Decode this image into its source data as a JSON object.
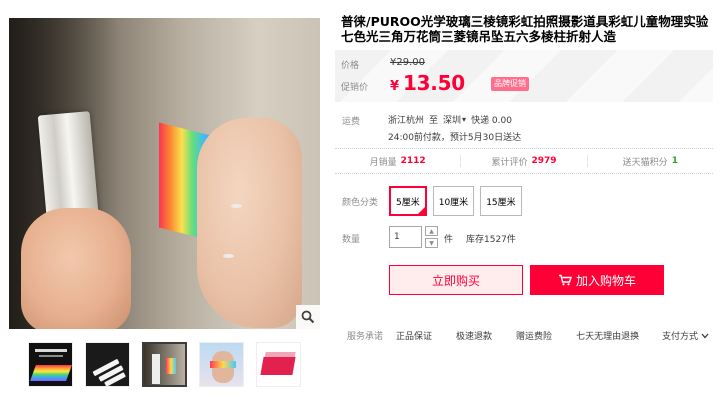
{
  "product": {
    "title": "普徕/PUROO光学玻璃三棱镜彩虹拍照摄影道具彩虹儿童物理实验七色光三角万花筒三菱镜吊坠五六多棱柱折射人造"
  },
  "gallery": {
    "zoom_icon": "magnifier-icon",
    "thumbnails": [
      "thumb-1",
      "thumb-2",
      "thumb-3",
      "thumb-4",
      "thumb-5"
    ],
    "active_index": 2
  },
  "price": {
    "label": "价格",
    "original": "¥29.00",
    "promo_label": "促销价",
    "currency": "¥",
    "promo_value": "13.50",
    "badge": "品牌促销"
  },
  "shipping": {
    "label": "运费",
    "from": "浙江杭州",
    "to_word": "至",
    "to": "深圳",
    "method": "快递 0.00",
    "note": "24:00前付款，预计5月30日送达"
  },
  "stats": {
    "sales_label": "月销量",
    "sales_value": "2112",
    "reviews_label": "累计评价",
    "reviews_value": "2979",
    "points_label": "送天猫积分",
    "points_value": "1"
  },
  "options": {
    "color_label": "颜色分类",
    "colors": [
      "5厘米",
      "10厘米",
      "15厘米"
    ],
    "selected_index": 0
  },
  "quantity": {
    "label": "数量",
    "value": "1",
    "unit": "件",
    "stock": "库存1527件"
  },
  "actions": {
    "buy_now": "立即购买",
    "add_cart": "加入购物车"
  },
  "services": {
    "label": "服务承诺",
    "items": [
      "正品保证",
      "极速退款",
      "赠运费险",
      "七天无理由退换"
    ],
    "payment": "支付方式"
  },
  "colors": {
    "accent": "#ff0036",
    "price_bg": "#f2f2f2",
    "badge_bg": "#ff6f8c",
    "points_green": "#22ab29"
  }
}
